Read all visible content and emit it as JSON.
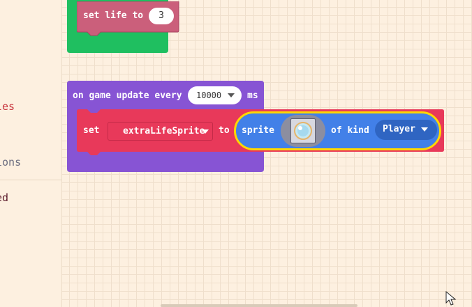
{
  "sidebar": {
    "items": [
      {
        "label": "les",
        "color": "#c8343d"
      },
      {
        "label": "ions",
        "color": "#6b6d80"
      },
      {
        "label": "ed",
        "color": "#5a1a2b"
      }
    ]
  },
  "blocks": {
    "set_life": {
      "label": "set life to",
      "value": "3"
    },
    "game_update": {
      "label": "on game update every",
      "interval": "10000",
      "unit": "ms"
    },
    "set_var": {
      "label": "set",
      "variable": "extraLifeSprite",
      "to_label": "to"
    },
    "sprite": {
      "label": "sprite",
      "image": "life-orb-sprite",
      "of_kind_label": "of kind",
      "kind": "Player"
    }
  },
  "colors": {
    "green": "#1fbf60",
    "pink": "#cb5f7b",
    "purple": "#8754d4",
    "red": "#e8395a",
    "blue": "#4280e8",
    "highlight": "#ffd700",
    "background": "#fdf0e0"
  }
}
